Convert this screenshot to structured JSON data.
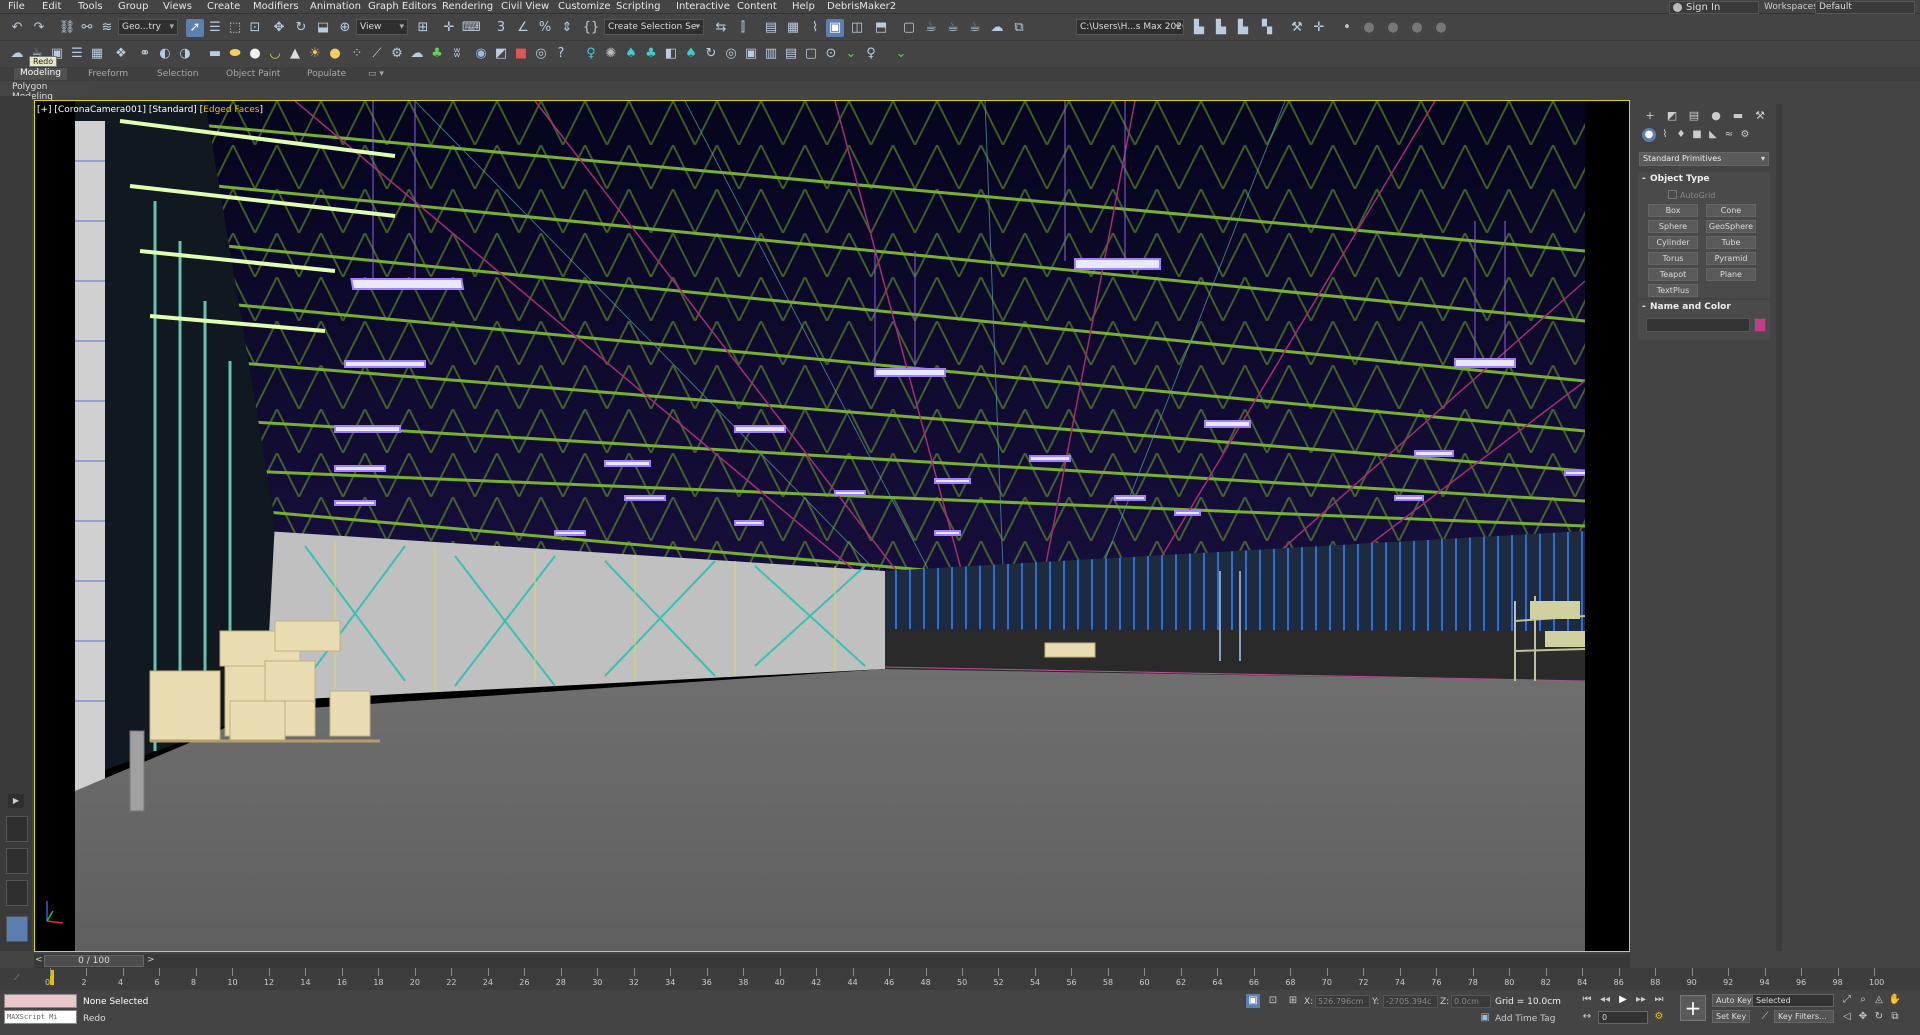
{
  "menu": [
    "File",
    "Edit",
    "Tools",
    "Group",
    "Views",
    "Create",
    "Modifiers",
    "Animation",
    "Graph Editors",
    "Rendering",
    "Civil View",
    "Customize",
    "Scripting",
    "Interactive",
    "Content",
    "Help",
    "DebrisMaker2"
  ],
  "account": {
    "sign_in": "Sign In",
    "workspaces_label": "Workspaces:",
    "workspace": "Default"
  },
  "toolbar": {
    "filter_select": "Geo...try",
    "ref_coord": "View",
    "named_selection": "Create Selection Se",
    "project_path": "C:\\Users\\H...s Max 2020"
  },
  "tooltip": "Redo",
  "ribbon": {
    "tabs": [
      "Modeling",
      "Freeform",
      "Selection",
      "Object Paint",
      "Populate"
    ],
    "active": "Modeling",
    "sublabel": "Polygon Modeling"
  },
  "viewport": {
    "label_prefix": "[+] [",
    "label_camera": "CoronaCamera001",
    "label_shading": "Standard",
    "label_mode": "Edged Faces",
    "label_end": "]"
  },
  "command_panel": {
    "category": "Standard Primitives",
    "object_type_title": "Object Type",
    "autogrid": "AutoGrid",
    "buttons": [
      "Box",
      "Cone",
      "Sphere",
      "GeoSphere",
      "Cylinder",
      "Tube",
      "Torus",
      "Pyramid",
      "Teapot",
      "Plane",
      "TextPlus"
    ],
    "name_color_title": "Name and Color",
    "color": "#c03c88"
  },
  "time_slider": {
    "value": "0 / 100",
    "prev": "<",
    "next": ">"
  },
  "trackbar": {
    "ticks": [
      0,
      2,
      4,
      6,
      8,
      10,
      12,
      14,
      16,
      18,
      20,
      22,
      24,
      26,
      28,
      30,
      32,
      34,
      36,
      38,
      40,
      42,
      44,
      46,
      48,
      50,
      52,
      54,
      56,
      58,
      60,
      62,
      64,
      66,
      68,
      70,
      72,
      74,
      76,
      78,
      80,
      82,
      84,
      86,
      88,
      90,
      92,
      94,
      96,
      98,
      100
    ]
  },
  "status": {
    "maxscript": "MAXScript Mi",
    "selection": "None Selected",
    "prompt": "Redo",
    "x_label": "X:",
    "x_value": "526.796cm",
    "y_label": "Y:",
    "y_value": "-2705.394c",
    "z_label": "Z:",
    "z_value": "0.0cm",
    "grid": "Grid = 10.0cm",
    "add_time_tag": "Add Time Tag",
    "auto_key": "Auto Key",
    "set_key": "Set Key",
    "selected_dd": "Selected",
    "key_filters": "Key Filters...",
    "frame": "0"
  }
}
